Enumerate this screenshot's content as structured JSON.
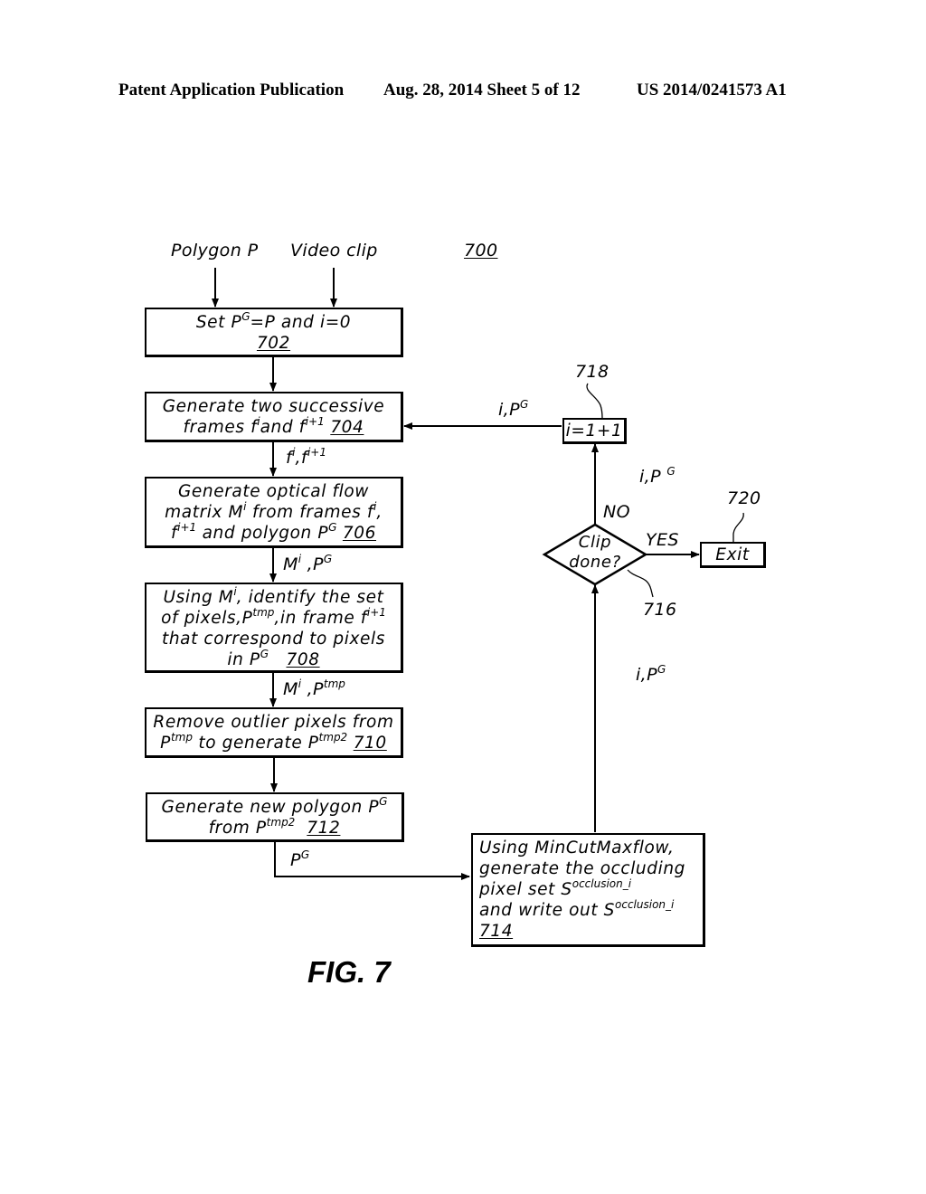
{
  "header": {
    "publication": "Patent Application Publication",
    "date_sheet": "Aug. 28, 2014  Sheet 5 of 12",
    "patent_number": "US 2014/0241573 A1"
  },
  "figure": {
    "ref": "700",
    "caption": "FIG. 7"
  },
  "inputs": {
    "polygon": "Polygon P",
    "video": "Video clip"
  },
  "steps": {
    "s702": {
      "ref": "702",
      "text_a": "Set P",
      "sup_a": "G",
      "text_b": "=P and i=0"
    },
    "s704": {
      "ref": "704",
      "line1": "Generate two successive",
      "text_a": "frames f",
      "sup_a": "i",
      "text_b": "and f",
      "sup_b": "i+1"
    },
    "s706": {
      "ref": "706",
      "line1": "Generate optical flow",
      "l2_a": "matrix M",
      "l2_sup": "i",
      "l2_b": " from frames f",
      "l2_sup2": "i",
      "l2_c": ",",
      "l3_a": "f",
      "l3_sup": "i+1",
      "l3_b": " and polygon P",
      "l3_sup2": "G"
    },
    "s708": {
      "ref": "708",
      "l1_a": "Using M",
      "l1_sup": "i",
      "l1_b": ", identify the set",
      "l2_a": "of pixels,P",
      "l2_sup": "tmp",
      "l2_b": ",in frame f",
      "l2_sup2": "i+1",
      "line3": "that correspond to pixels",
      "l4_a": "in P",
      "l4_sup": "G"
    },
    "s710": {
      "ref": "710",
      "line1": "Remove outlier pixels from",
      "l2_a": "P",
      "l2_sup": "tmp",
      "l2_b": " to generate P",
      "l2_sup2": "tmp2"
    },
    "s712": {
      "ref": "712",
      "l1_a": "Generate new polygon P",
      "l1_sup": "G",
      "l2_a": "from P",
      "l2_sup": "tmp2"
    },
    "s714": {
      "ref": "714",
      "line1": "Using MinCutMaxflow,",
      "line2": "generate the occluding",
      "l3_a": "pixel set S",
      "l3_sup": "occlusion_i",
      "l4_a": "and write out S",
      "l4_sup": "occlusion_i"
    },
    "s716": {
      "ref": "716",
      "line1": "Clip",
      "line2": "done?"
    },
    "s718": {
      "ref": "718",
      "text": "i=1+1"
    },
    "s720": {
      "ref": "720",
      "text": "Exit"
    }
  },
  "edge_labels": {
    "e704_706": {
      "a": "f",
      "sup_a": "i",
      "b": ",f",
      "sup_b": "i+1"
    },
    "e706_708": {
      "a": "M",
      "sup_a": "i",
      "b": " ,P",
      "sup_b": "G"
    },
    "e708_710": {
      "a": "M",
      "sup_a": "i",
      "b": " ,P",
      "sup_b": "tmp"
    },
    "e712_714": {
      "a": "P",
      "sup_a": "G"
    },
    "e718_704": {
      "a": "i,P",
      "sup_a": "G"
    },
    "e716_718": {
      "a": "i,P ",
      "sup_a": "G"
    },
    "e714_716": {
      "a": "i,P",
      "sup_a": "G"
    },
    "no": "NO",
    "yes": "YES"
  }
}
